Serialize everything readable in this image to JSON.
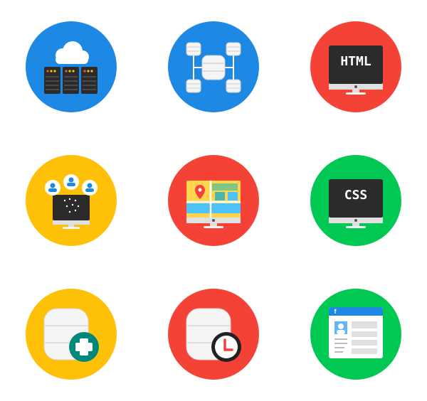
{
  "icons": [
    {
      "name": "cloud-server-icon",
      "bg": "#1E88E5"
    },
    {
      "name": "database-network-icon",
      "bg": "#1E88E5"
    },
    {
      "name": "html-monitor-icon",
      "bg": "#F44336",
      "screen_text": "HTML"
    },
    {
      "name": "network-users-monitor-icon",
      "bg": "#FFC107"
    },
    {
      "name": "map-monitor-icon",
      "bg": "#F44336"
    },
    {
      "name": "css-monitor-icon",
      "bg": "#00C853",
      "screen_text": "CSS"
    },
    {
      "name": "database-add-icon",
      "bg": "#FFC107"
    },
    {
      "name": "database-clock-icon",
      "bg": "#F44336"
    },
    {
      "name": "facebook-profile-icon",
      "bg": "#00C853",
      "brand_letter": "f"
    }
  ],
  "colors": {
    "blue": "#1E88E5",
    "red": "#F44336",
    "yellow": "#FFC107",
    "green": "#00C853",
    "monitor_dark": "#2B2B2B",
    "db_light": "#F5F5F5",
    "teal": "#00897B"
  }
}
